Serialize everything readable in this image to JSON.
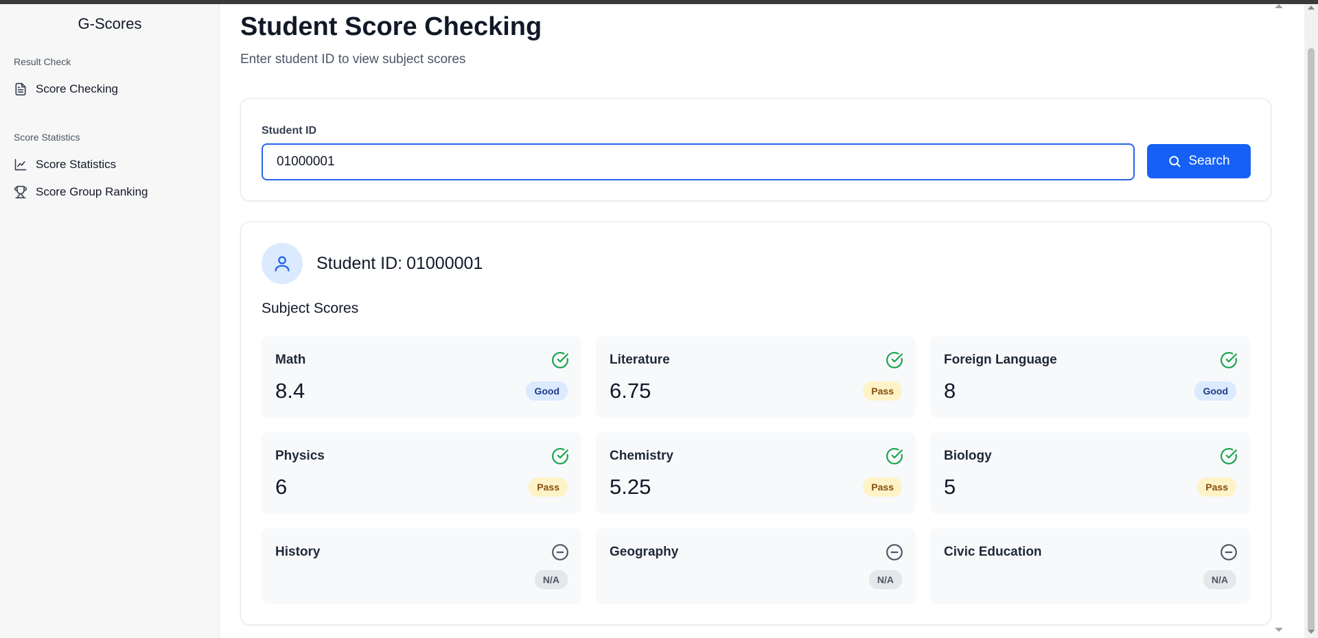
{
  "sidebar": {
    "brand": "G-Scores",
    "sections": [
      {
        "label": "Result Check",
        "items": [
          {
            "label": "Score Checking",
            "icon": "document-icon"
          }
        ]
      },
      {
        "label": "Score Statistics",
        "items": [
          {
            "label": "Score Statistics",
            "icon": "line-chart-icon"
          },
          {
            "label": "Score Group Ranking",
            "icon": "trophy-icon"
          }
        ]
      }
    ]
  },
  "page": {
    "title": "Student Score Checking",
    "subtitle": "Enter student ID to view subject scores"
  },
  "search": {
    "label": "Student ID",
    "value": "01000001",
    "button_label": "Search",
    "button_icon": "search-icon",
    "accent_color": "#1660f5"
  },
  "result": {
    "heading_prefix": "Student ID:",
    "student_id": "01000001",
    "avatar_icon": "user-icon",
    "scores_title": "Subject Scores",
    "subjects": [
      {
        "name": "Math",
        "score": "8.4",
        "badge": "Good",
        "status": "check-circle-icon"
      },
      {
        "name": "Literature",
        "score": "6.75",
        "badge": "Pass",
        "status": "check-circle-icon"
      },
      {
        "name": "Foreign Language",
        "score": "8",
        "badge": "Good",
        "status": "check-circle-icon"
      },
      {
        "name": "Physics",
        "score": "6",
        "badge": "Pass",
        "status": "check-circle-icon"
      },
      {
        "name": "Chemistry",
        "score": "5.25",
        "badge": "Pass",
        "status": "check-circle-icon"
      },
      {
        "name": "Biology",
        "score": "5",
        "badge": "Pass",
        "status": "check-circle-icon"
      },
      {
        "name": "History",
        "score": "",
        "badge": "N/A",
        "status": "minus-circle-icon"
      },
      {
        "name": "Geography",
        "score": "",
        "badge": "N/A",
        "status": "minus-circle-icon"
      },
      {
        "name": "Civic Education",
        "score": "",
        "badge": "N/A",
        "status": "minus-circle-icon"
      }
    ]
  },
  "colors": {
    "good_badge_bg": "#dbeafe",
    "pass_badge_bg": "#fef3c7",
    "na_badge_bg": "#e5e7eb",
    "check_color": "#16a34a"
  }
}
